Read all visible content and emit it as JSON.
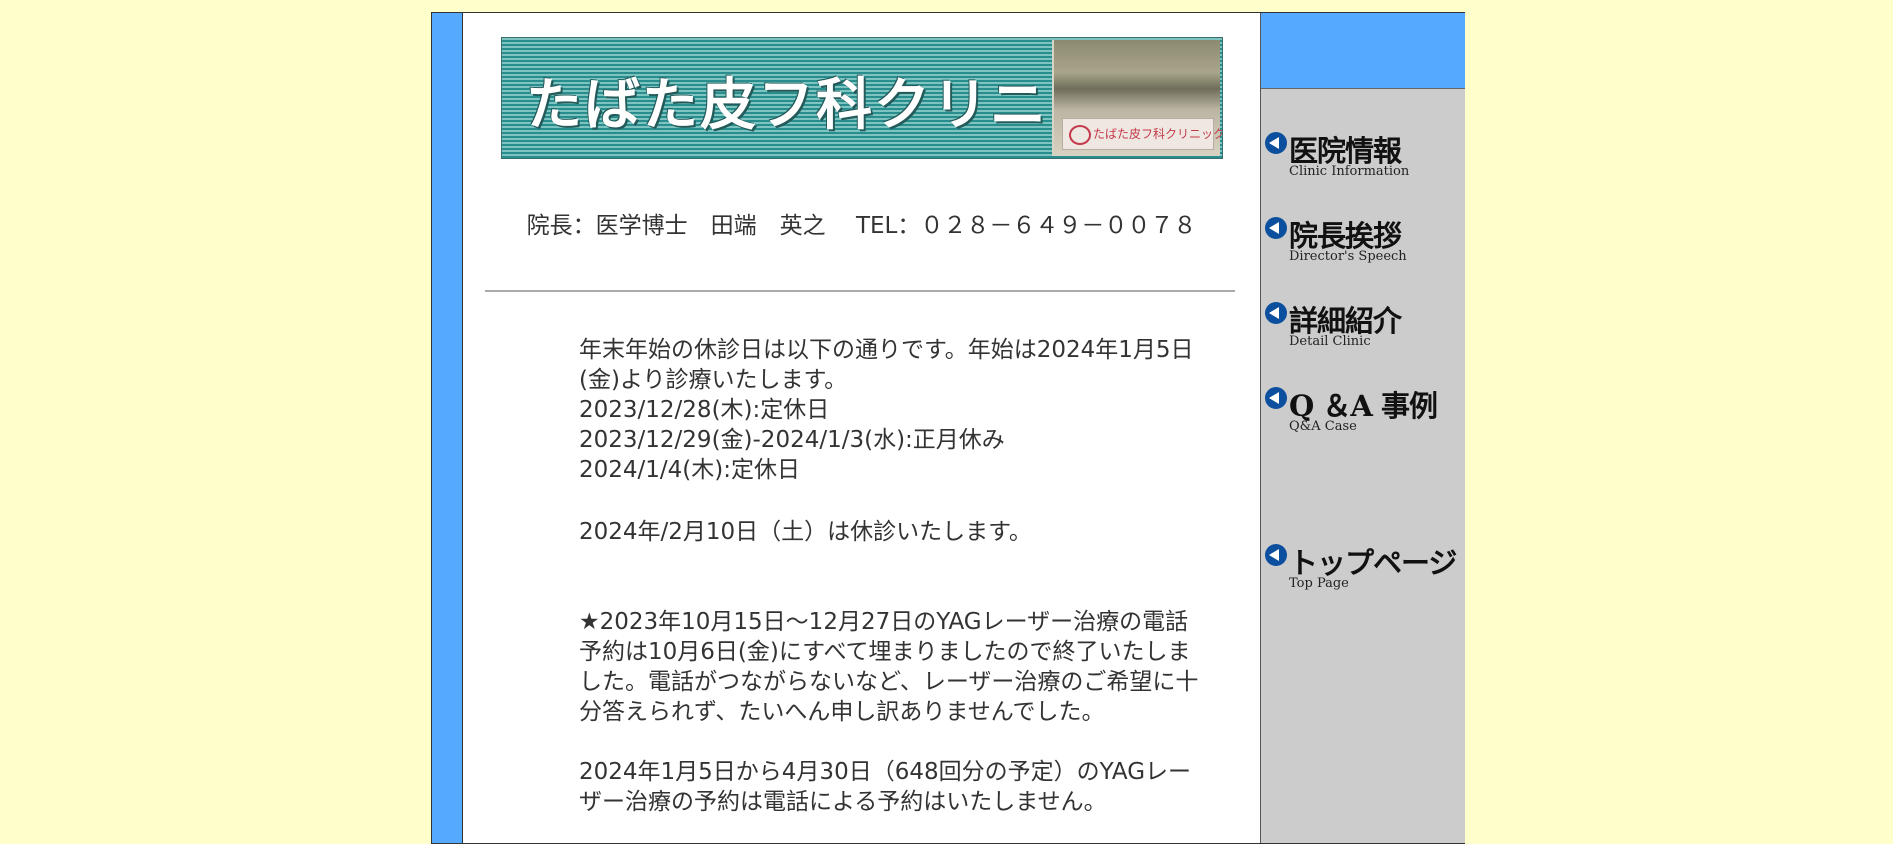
{
  "banner": {
    "title": "たばた皮フ科クリニック",
    "sign_text": "たばた皮フ科クリニック"
  },
  "header": {
    "director_line": "院長：医学博士　田端　英之　 TEL：０２８－６４９－００７８"
  },
  "notices": [
    {
      "lines": [
        "年末年始の休診日は以下の通りです。年始は2024年1月5日(金)より診療いたします。",
        "2023/12/28(木):定休日",
        "2023/12/29(金)-2024/1/3(水):正月休み",
        "2024/1/4(木):定休日"
      ]
    },
    {
      "lines": [
        "2024年/2月10日（土）は休診いたします。"
      ]
    },
    {
      "lines": [
        "★2023年10月15日～12月27日のYAGレーザー治療の電話予約は10月6日(金)にすべて埋まりましたので終了いたしました。電話がつながらないなど、レーザー治療のご希望に十分答えられず、たいへん申し訳ありませんでした。"
      ]
    },
    {
      "lines": [
        "2024年1月5日から4月30日（648回分の予定）のYAGレーザー治療の予約は電話による予約はいたしません。"
      ]
    }
  ],
  "sidebar": {
    "items": [
      {
        "label": "医院情報",
        "sub": "Clinic Information",
        "icon": "arrow-left-circle-icon"
      },
      {
        "label": "院長挨拶",
        "sub": "Director's Speech",
        "icon": "arrow-left-circle-icon"
      },
      {
        "label": "詳細紹介",
        "sub": "Detail Clinic",
        "icon": "arrow-left-circle-icon"
      },
      {
        "label": "Q ＆A 事例",
        "sub": "Q&A Case",
        "icon": "arrow-left-circle-icon"
      },
      {
        "label": "トップページ",
        "sub": "Top Page",
        "icon": "arrow-left-circle-icon"
      }
    ]
  },
  "colors": {
    "page_background": "#ffffcc",
    "accent_blue": "#55aaff",
    "sidebar_gray": "#cccccc",
    "banner_teal": "#2a8d8d"
  }
}
